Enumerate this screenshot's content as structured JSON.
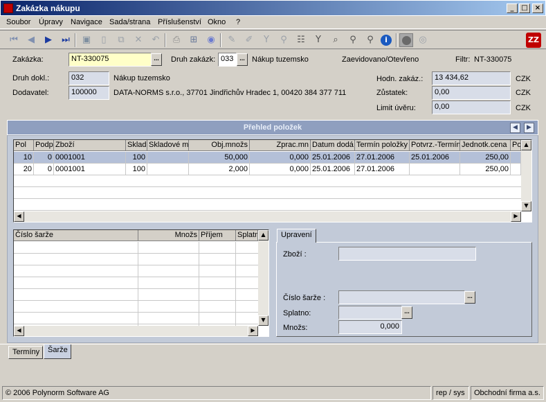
{
  "window": {
    "title": "Zakázka nákupu",
    "minimize": "_",
    "maximize": "□",
    "close": "×"
  },
  "menu": [
    "Soubor",
    "Úpravy",
    "Navigace",
    "Sada/strana",
    "Příslušenství",
    "Okno",
    "?"
  ],
  "header": {
    "zakazka_label": "Zakázka:",
    "zakazka_value": "NT-330075",
    "druh_zakazky_label": "Druh zakázk:",
    "druh_zakazky_value": "033",
    "druh_zakazky_text": "Nákup tuzemsko",
    "status": "Zaevidovano/Otevřeno",
    "filtr_label": "Filtr:",
    "filtr_value": "NT-330075",
    "druh_dokl_label": "Druh dokl.:",
    "druh_dokl_value": "032",
    "druh_dokl_text": "Nákup tuzemsko",
    "dodavatel_label": "Dodavatel:",
    "dodavatel_value": "100000",
    "dodavatel_text": "DATA-NORMS s.r.o., 37701 Jindřichův Hradec 1, 00420 384 377 711",
    "hodn_label": "Hodn. zakáz.:",
    "hodn_value": "13 434,62",
    "zustatek_label": "Zůstatek:",
    "zustatek_value": "0,00",
    "limit_label": "Limit úvěru:",
    "limit_value": "0,00",
    "currency": "CZK"
  },
  "panel": {
    "title": "Přehled položek",
    "prev": "◀",
    "next": "▶"
  },
  "items_grid": {
    "columns": [
      "Pol",
      "Podp",
      "Zboží",
      "Sklad",
      "Skladové m",
      "Obj.množs",
      "Zprac.mn",
      "Datum dodá",
      "Termín položky",
      "Potvrz.-Termín",
      "Jednotk.cena",
      "Po"
    ],
    "rows": [
      [
        "10",
        "0",
        "0001001",
        "100",
        "",
        "50,000",
        "0,000",
        "25.01.2006",
        "27.01.2006",
        "25.01.2006",
        "250,00",
        ""
      ],
      [
        "20",
        "0",
        "0001001",
        "100",
        "",
        "2,000",
        "0,000",
        "25.01.2006",
        "27.01.2006",
        "",
        "250,00",
        ""
      ]
    ]
  },
  "batch_grid": {
    "columns": [
      "Číslo šarže",
      "Množs",
      "Příjem",
      "Splatn"
    ]
  },
  "edit_tab": {
    "tab_label": "Upravení",
    "zbozi_label": "Zboží  :",
    "zbozi_value": "",
    "cislo_sarze_label": "Číslo šarže  :",
    "cislo_sarze_value": "",
    "splatno_label": "Splatno:",
    "splatno_value": "",
    "mnozs_label": "Množs:",
    "mnozs_value": "0,000"
  },
  "bottom_tabs": [
    "Termíny",
    "Šarže"
  ],
  "status": {
    "copyright": "© 2006 Polynorm Software AG",
    "user": "rep / sys",
    "company": "Obchodní firma a.s."
  },
  "colors": {
    "title_start": "#0a246a",
    "title_end": "#a6caf0",
    "panel": "#8f9fbf",
    "selected_row": "#b4c0d8"
  }
}
